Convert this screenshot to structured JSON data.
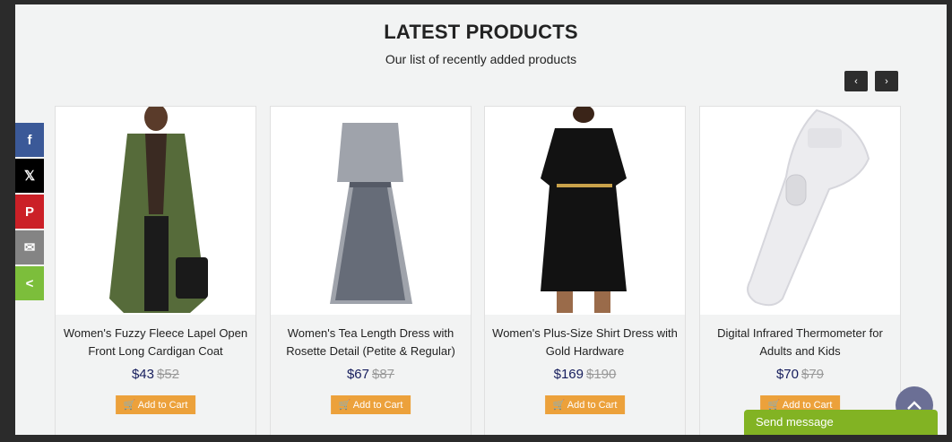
{
  "section": {
    "title": "LATEST PRODUCTS",
    "subtitle": "Our list of recently added products"
  },
  "carousel": {
    "prev": "‹",
    "next": "›"
  },
  "products": [
    {
      "name": "Women's Fuzzy Fleece Lapel Open Front Long Cardigan Coat",
      "price": "$43",
      "old_price": "$52",
      "cart_label": "Add to Cart"
    },
    {
      "name": "Women's Tea Length Dress with Rosette Detail (Petite & Regular)",
      "price": "$67",
      "old_price": "$87",
      "cart_label": "Add to Cart"
    },
    {
      "name": "Women's Plus-Size Shirt Dress with Gold Hardware",
      "price": "$169",
      "old_price": "$190",
      "cart_label": "Add to Cart"
    },
    {
      "name": "Digital Infrared Thermometer for Adults and Kids",
      "price": "$70",
      "old_price": "$79",
      "cart_label": "Add to Cart"
    }
  ],
  "share": {
    "facebook": "f",
    "twitter": "𝕏",
    "pinterest": "P",
    "email": "✉",
    "share": "<"
  },
  "chat": {
    "label": "Send message"
  },
  "colors": {
    "accent": "#eca13b",
    "price": "#161d5c",
    "chat": "#82b323"
  }
}
